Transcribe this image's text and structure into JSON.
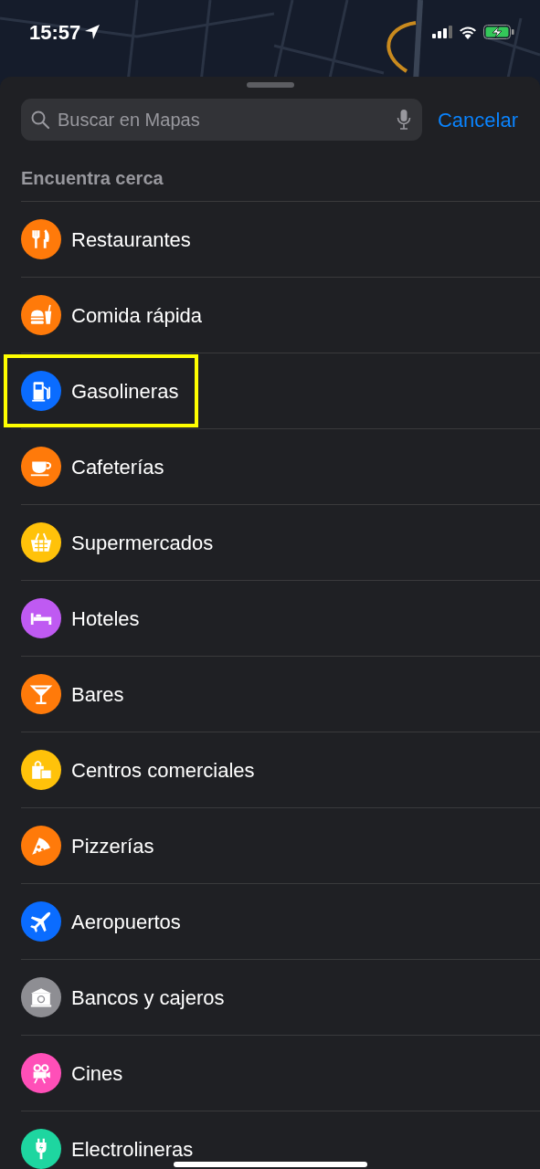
{
  "status_bar": {
    "time": "15:57"
  },
  "search": {
    "placeholder": "Buscar en Mapas",
    "cancel": "Cancelar"
  },
  "section_title": "Encuentra cerca",
  "items": [
    {
      "label": "Restaurantes",
      "kind": "restaurant",
      "color": "#ff7a0a",
      "highlighted": false
    },
    {
      "label": "Comida rápida",
      "kind": "fastfood",
      "color": "#ff7a0a",
      "highlighted": false
    },
    {
      "label": "Gasolineras",
      "kind": "fuel",
      "color": "#0a6cff",
      "highlighted": true
    },
    {
      "label": "Cafeterías",
      "kind": "cafe",
      "color": "#ff7a0a",
      "highlighted": false
    },
    {
      "label": "Supermercados",
      "kind": "grocery",
      "color": "#ffc20a",
      "highlighted": false
    },
    {
      "label": "Hoteles",
      "kind": "hotel",
      "color": "#bf5af2",
      "highlighted": false
    },
    {
      "label": "Bares",
      "kind": "bar",
      "color": "#ff7a0a",
      "highlighted": false
    },
    {
      "label": "Centros comerciales",
      "kind": "mall",
      "color": "#ffc20a",
      "highlighted": false
    },
    {
      "label": "Pizzerías",
      "kind": "pizza",
      "color": "#ff7a0a",
      "highlighted": false
    },
    {
      "label": "Aeropuertos",
      "kind": "airport",
      "color": "#0a6cff",
      "highlighted": false
    },
    {
      "label": "Bancos y cajeros",
      "kind": "bank",
      "color": "#8e8e93",
      "highlighted": false
    },
    {
      "label": "Cines",
      "kind": "cinema",
      "color": "#ff4fb8",
      "highlighted": false
    },
    {
      "label": "Electrolineras",
      "kind": "ev",
      "color": "#1ed6a0",
      "highlighted": false
    }
  ]
}
